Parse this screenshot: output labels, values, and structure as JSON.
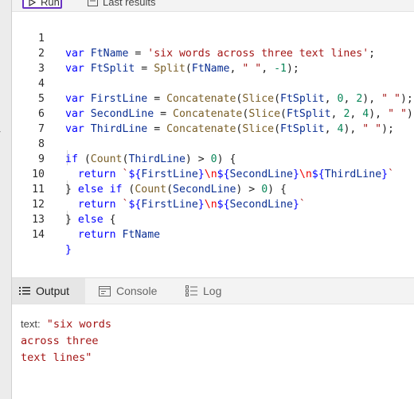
{
  "toolbar": {
    "run_label": "Run",
    "results_label": "Last results"
  },
  "code": {
    "line_numbers": [
      "1",
      "2",
      "3",
      "4",
      "5",
      "6",
      "7",
      "8",
      "9",
      "10",
      "11",
      "12",
      "13",
      "14"
    ]
  },
  "panel": {
    "tabs": [
      {
        "label": "Output",
        "icon": "list-icon"
      },
      {
        "label": "Console",
        "icon": "console-icon"
      },
      {
        "label": "Log",
        "icon": "log-icon"
      }
    ],
    "active_tab": "Output"
  },
  "output": {
    "key": "text:",
    "lines": [
      "\"six words",
      "across three",
      "text lines\""
    ]
  }
}
